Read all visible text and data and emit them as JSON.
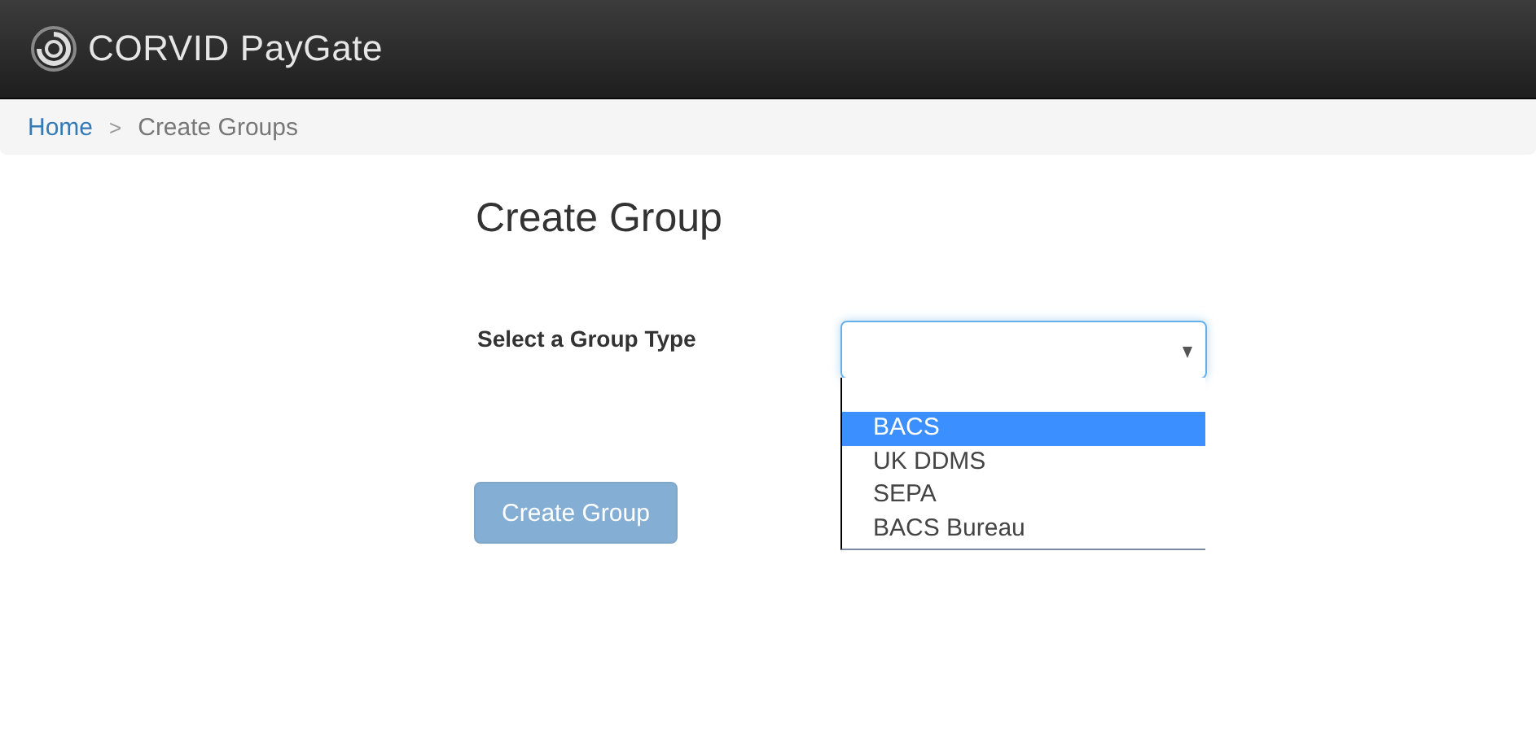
{
  "header": {
    "brand": "CORVID PayGate"
  },
  "breadcrumb": [
    {
      "label": "Home",
      "kind": "link"
    },
    {
      "label": ">",
      "kind": "separator"
    },
    {
      "label": "Create Groups",
      "kind": "current"
    }
  ],
  "page_title": "Create Group",
  "form": {
    "label": "Select a Group Type",
    "dropdown": {
      "expanded": true,
      "options": [
        {
          "label": "BACS",
          "selected": true
        },
        {
          "label": "UK DDMS",
          "selected": false
        },
        {
          "label": "SEPA",
          "selected": false
        },
        {
          "label": "BACS Bureau",
          "selected": false
        }
      ]
    }
  },
  "submit": {
    "label": "Create Group",
    "disabled": true
  }
}
